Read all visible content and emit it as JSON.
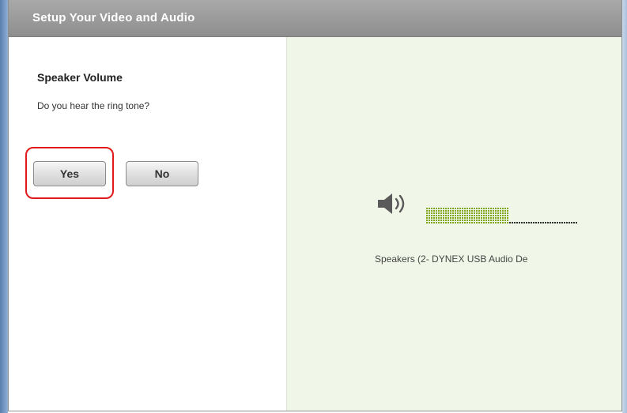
{
  "dialog": {
    "title": "Setup Your Video and Audio"
  },
  "speaker_section": {
    "title": "Speaker Volume",
    "question": "Do you hear the ring tone?",
    "yes_label": "Yes",
    "no_label": "No"
  },
  "audio_output": {
    "device_name": "Speakers (2- DYNEX USB Audio De",
    "level_fraction": 0.55,
    "icon": "speaker-volume-icon"
  },
  "colors": {
    "title_bar": "#9a9a9a",
    "right_pane_bg": "#f1f7e8",
    "meter_active": "#7fa61b",
    "meter_inactive": "#2e2e2e",
    "highlight": "#e01a1a"
  }
}
